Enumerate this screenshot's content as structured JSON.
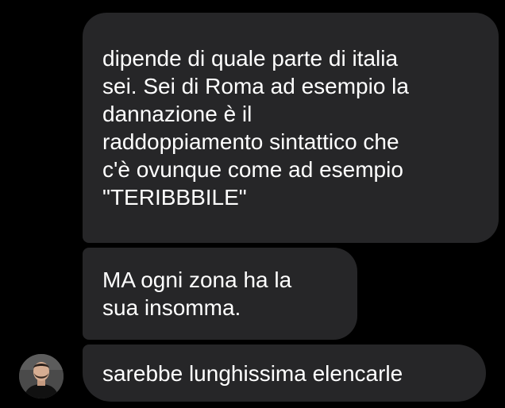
{
  "messages": [
    {
      "text": "dipende di quale parte di italia\nsei. Sei di Roma ad esempio la\ndannazione è il\nraddoppiamento sintattico che\nc'è ovunque come ad esempio\n\"TERIBBBILE\""
    },
    {
      "text": "MA ogni zona ha la\nsua insomma."
    },
    {
      "text": "sarebbe lunghissima elencarle"
    }
  ],
  "sender": {
    "avatar_icon": "person-avatar"
  },
  "colors": {
    "background": "#000000",
    "bubble": "#262628",
    "text": "#ffffff"
  }
}
